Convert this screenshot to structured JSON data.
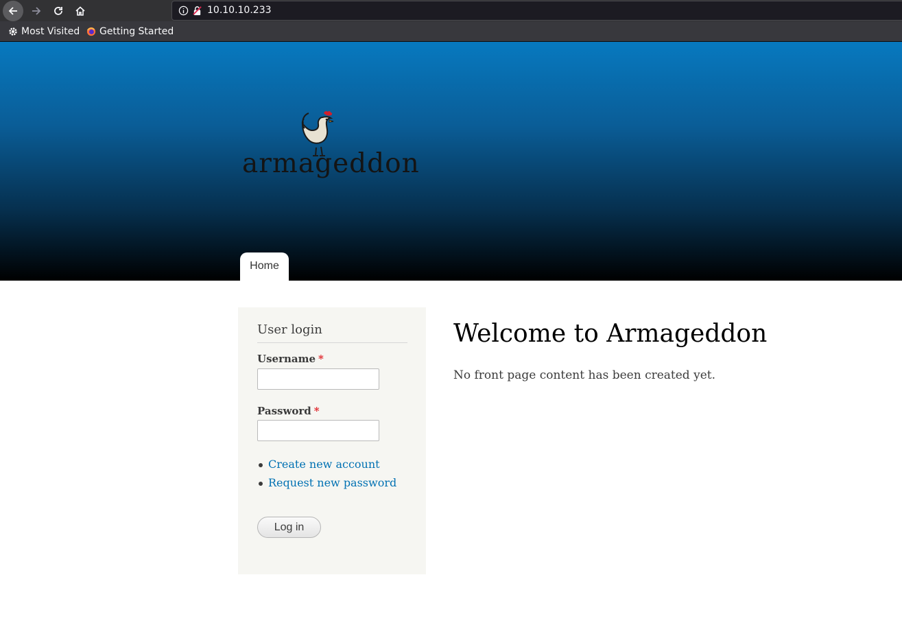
{
  "browser": {
    "url": "10.10.10.233",
    "bookmarks": [
      {
        "label": "Most Visited",
        "icon": "gear-icon"
      },
      {
        "label": "Getting Started",
        "icon": "firefox-icon"
      }
    ]
  },
  "site": {
    "logo_text": "armageddon",
    "nav": [
      {
        "label": "Home"
      }
    ]
  },
  "login_block": {
    "title": "User login",
    "username_label": "Username",
    "password_label": "Password",
    "required_marker": "*",
    "username_value": "",
    "password_value": "",
    "links": [
      "Create new account",
      "Request new password"
    ],
    "submit_label": "Log in"
  },
  "main": {
    "title": "Welcome to Armageddon",
    "text": "No front page content has been created yet."
  },
  "colors": {
    "header_top": "#0779bf",
    "header_bottom": "#000000",
    "link": "#0071b3",
    "required": "#e0252b",
    "sidebar_bg": "#f6f6f2"
  }
}
